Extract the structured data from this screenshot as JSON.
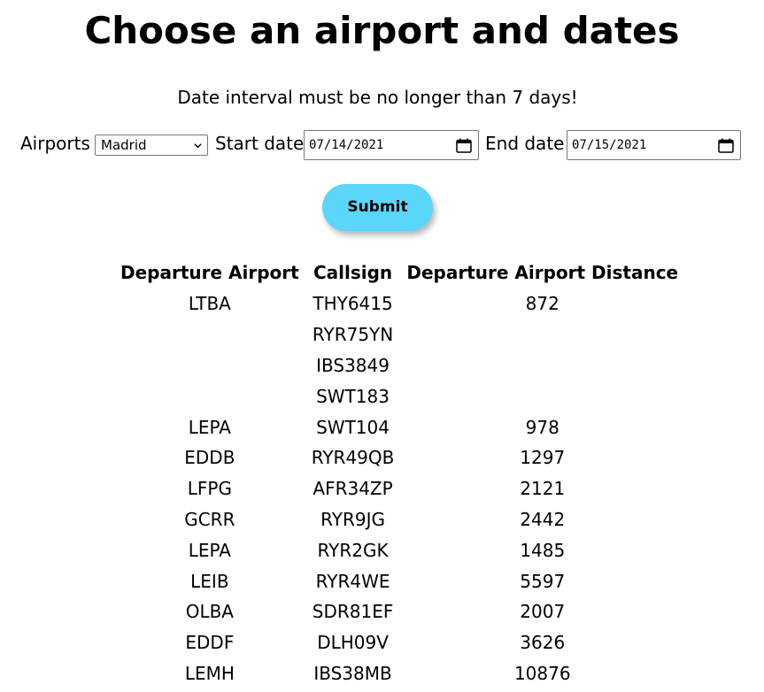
{
  "header": {
    "title": "Choose an airport and dates",
    "notice": "Date interval must be no longer than 7 days!"
  },
  "form": {
    "airports_label": "Airports",
    "airport_selected": "Madrid",
    "start_label": "Start date",
    "start_value": "07/14/2021",
    "end_label": "End date",
    "end_value": "07/15/2021",
    "submit_label": "Submit"
  },
  "table": {
    "columns": [
      "Departure Airport",
      "Callsign",
      "Departure Airport Distance"
    ],
    "rows": [
      [
        "LTBA",
        "THY6415",
        "872"
      ],
      [
        "",
        "RYR75YN",
        ""
      ],
      [
        "",
        "IBS3849",
        ""
      ],
      [
        "",
        "SWT183",
        ""
      ],
      [
        "LEPA",
        "SWT104",
        "978"
      ],
      [
        "EDDB",
        "RYR49QB",
        "1297"
      ],
      [
        "LFPG",
        "AFR34ZP",
        "2121"
      ],
      [
        "GCRR",
        "RYR9JG",
        "2442"
      ],
      [
        "LEPA",
        "RYR2GK",
        "1485"
      ],
      [
        "LEIB",
        "RYR4WE",
        "5597"
      ],
      [
        "OLBA",
        "SDR81EF",
        "2007"
      ],
      [
        "EDDF",
        "DLH09V",
        "3626"
      ],
      [
        "LEMH",
        "IBS38MB",
        "10876"
      ]
    ]
  },
  "icons": {
    "select": "chevron-down-icon",
    "date": "calendar-icon"
  },
  "colors": {
    "submit_background": "#5bd5f9"
  }
}
